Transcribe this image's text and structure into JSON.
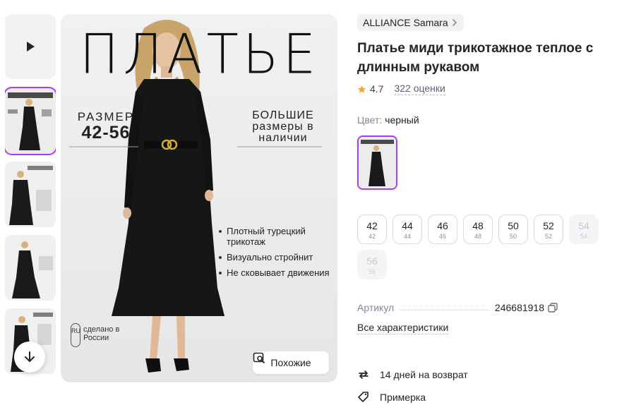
{
  "gallery": {
    "video_icon": "play-icon",
    "thumbnails_count": 5,
    "scroll_icon": "arrow-down-icon"
  },
  "main_image": {
    "headline": "ПЛАТЬЕ",
    "size_label": "РАЗМЕР",
    "size_range": "42-56",
    "big_sizes": "БОЛЬШИЕ размеры в наличии",
    "bullets": [
      "Плотный турецкий трикотаж",
      "Визуально стройнит",
      "Не сковывает движения"
    ],
    "origin_badge": "RU",
    "origin_text": "сделано в России",
    "similar_button": "Похожие"
  },
  "product": {
    "brand": "ALLIANCE Samara",
    "title": "Платье миди трикотажное теплое с длинным рукавом",
    "rating": "4.7",
    "reviews": "322 оценки",
    "color_label": "Цвет:",
    "color_value": "черный",
    "sizes": [
      {
        "size": "42",
        "ru": "42",
        "available": true
      },
      {
        "size": "44",
        "ru": "44",
        "available": true
      },
      {
        "size": "46",
        "ru": "46",
        "available": true
      },
      {
        "size": "48",
        "ru": "48",
        "available": true
      },
      {
        "size": "50",
        "ru": "50",
        "available": true
      },
      {
        "size": "52",
        "ru": "52",
        "available": true
      },
      {
        "size": "54",
        "ru": "54",
        "available": false
      },
      {
        "size": "56",
        "ru": "56",
        "available": false
      }
    ],
    "article_label": "Артикул",
    "article_number": "246681918",
    "all_specs": "Все характеристики",
    "returns": "14 дней на возврат",
    "fitting": "Примерка"
  },
  "colors": {
    "accent": "#a73afd",
    "star": "#f5a623",
    "text": "#242424",
    "muted": "#868695"
  }
}
